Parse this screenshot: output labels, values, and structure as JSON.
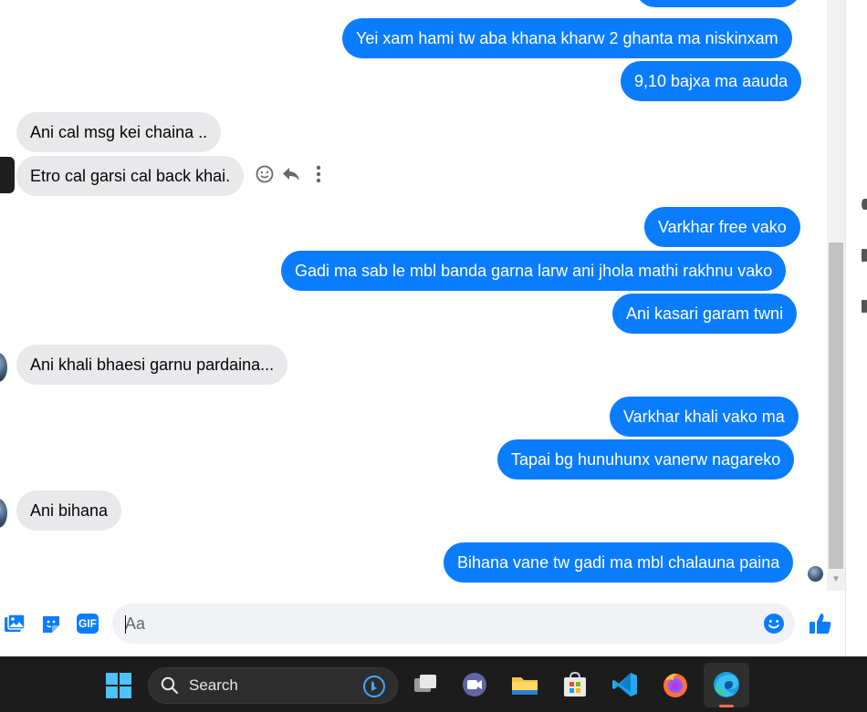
{
  "colors": {
    "outgoing_bubble": "#0a7cff",
    "incoming_bubble": "#e9e9eb",
    "accent": "#0a7cff",
    "taskbar": "#1c1c1c"
  },
  "conversation": {
    "messages": [
      {
        "direction": "out",
        "text": "Yei xam hami tw aba khana kharw 2 ghanta ma niskinxam"
      },
      {
        "direction": "out",
        "text": "9,10 bajxa ma aauda"
      },
      {
        "direction": "in",
        "text": "Ani cal msg kei chaina .."
      },
      {
        "direction": "in",
        "text": "Etro cal garsi cal back khai."
      },
      {
        "direction": "out",
        "text": "Varkhar free vako"
      },
      {
        "direction": "out",
        "text": "Gadi ma sab le mbl banda garna larw ani jhola mathi rakhnu vako"
      },
      {
        "direction": "out",
        "text": "Ani kasari garam twni"
      },
      {
        "direction": "in",
        "text": "Ani khali bhaesi garnu pardaina..."
      },
      {
        "direction": "out",
        "text": "Varkhar khali vako ma"
      },
      {
        "direction": "out",
        "text": "Tapai bg hunuhunx vanerw nagareko"
      },
      {
        "direction": "in",
        "text": "Ani bihana"
      },
      {
        "direction": "out",
        "text": "Bihana vane tw gadi ma mbl chalauna paina"
      }
    ]
  },
  "message_actions": {
    "icons": [
      "emoji-react-icon",
      "reply-icon",
      "more-options-icon"
    ]
  },
  "composer": {
    "placeholder": "Aa",
    "icons": [
      "photo-icon",
      "sticker-icon",
      "gif-icon",
      "emoji-icon",
      "like-thumbs-up-icon"
    ],
    "gif_label": "GIF"
  },
  "taskbar": {
    "search_label": "Search",
    "apps": [
      "windows-start-icon",
      "task-view-icon",
      "teams-meet-icon",
      "file-explorer-icon",
      "microsoft-store-icon",
      "vscode-icon",
      "firefox-icon",
      "edge-icon"
    ],
    "active_app": "edge-icon"
  }
}
